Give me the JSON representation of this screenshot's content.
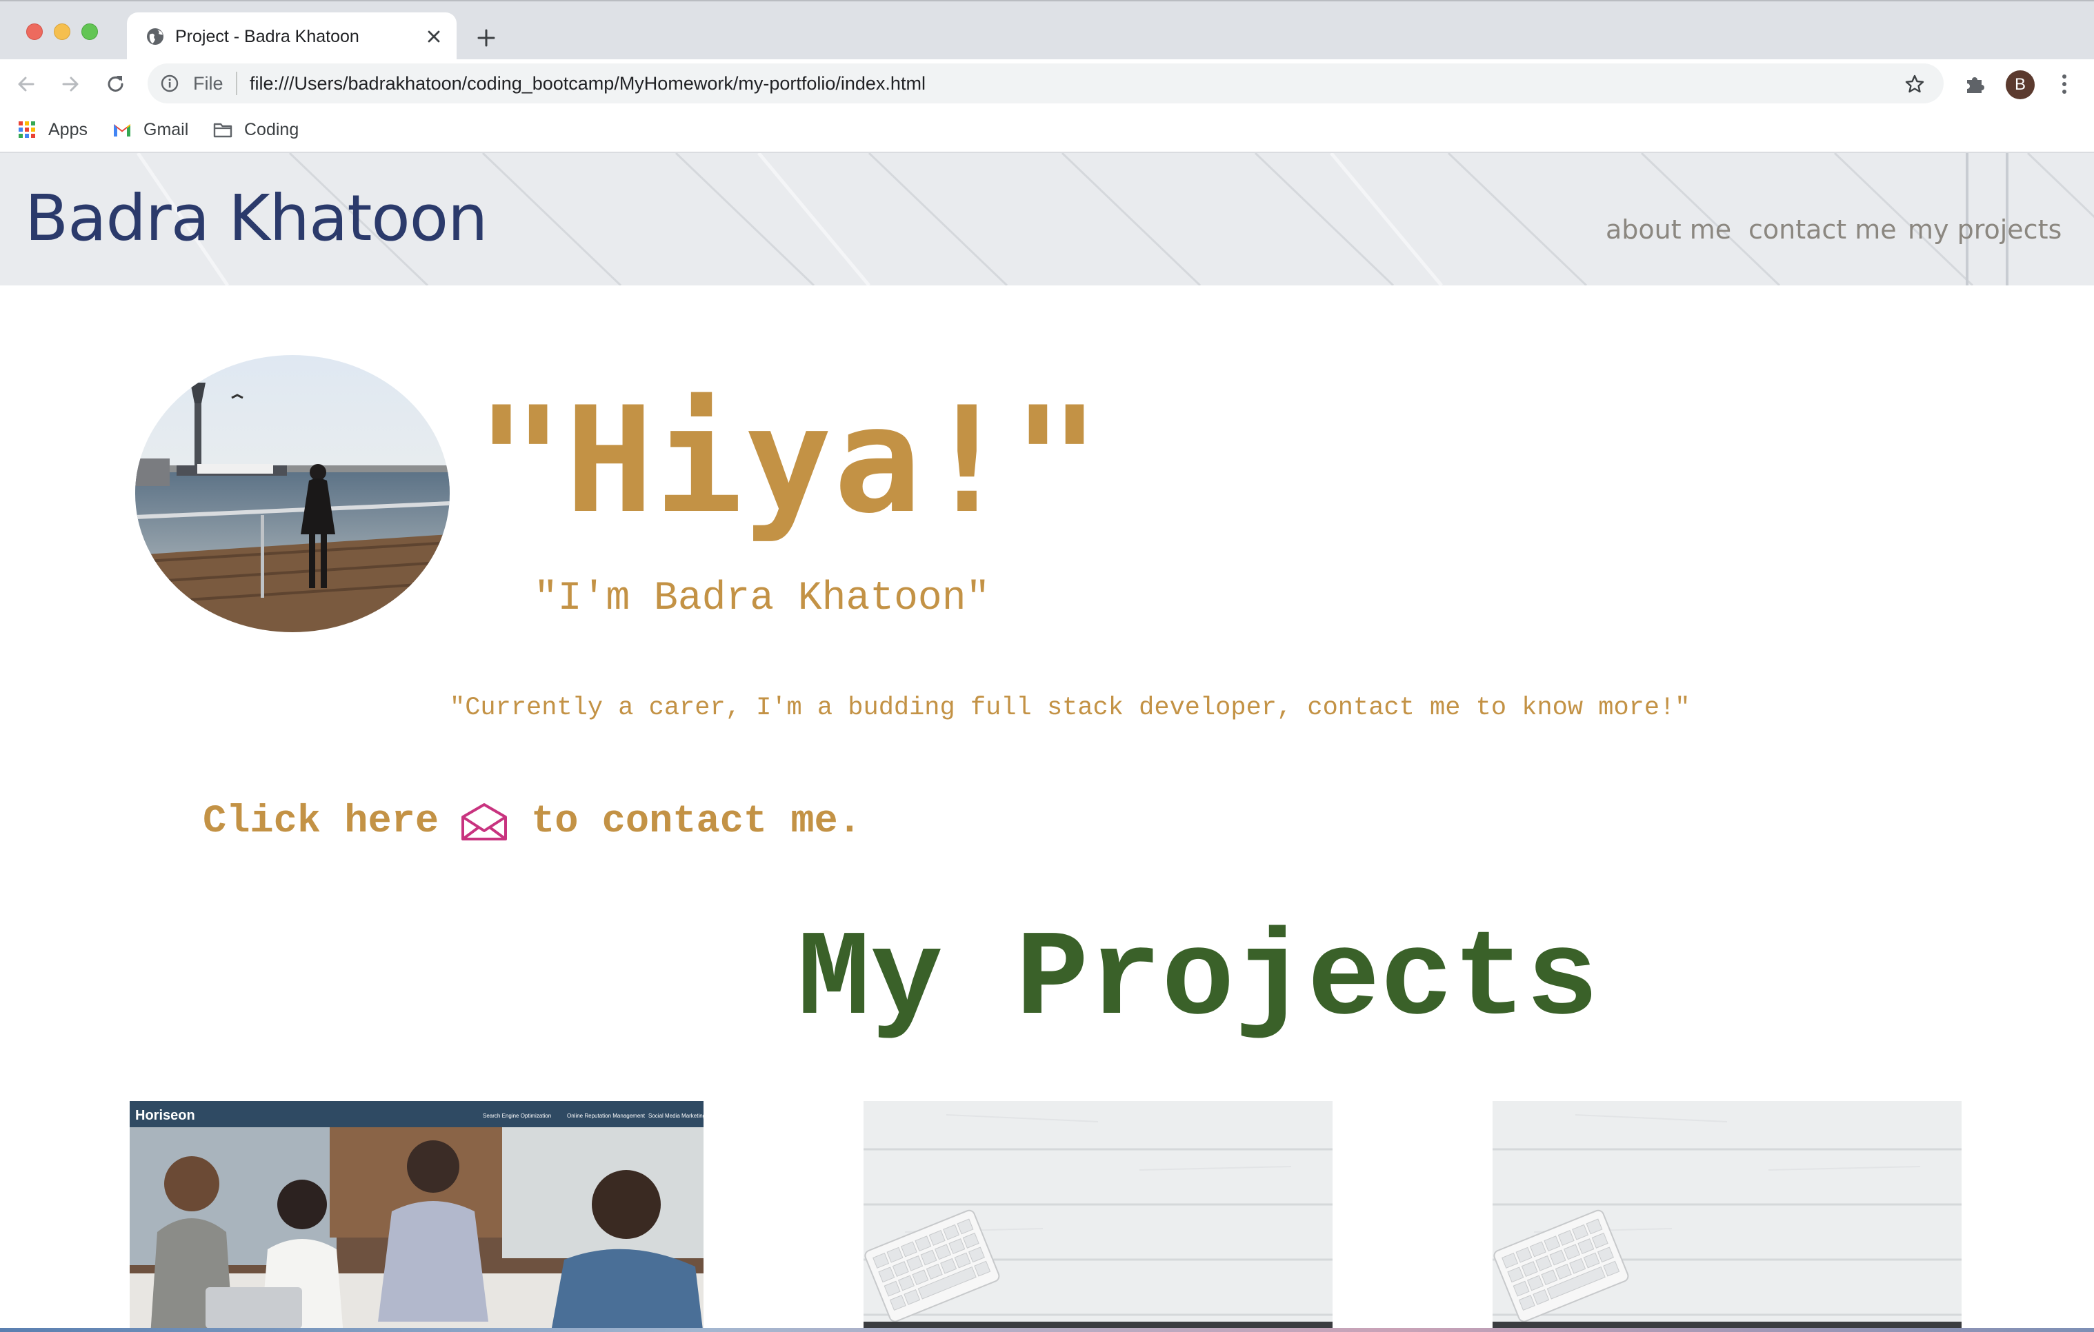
{
  "browser": {
    "tab": {
      "title": "Project - Badra Khatoon",
      "favicon": "globe-icon"
    },
    "toolbar": {
      "scheme_label": "File",
      "url": "file:///Users/badrakhatoon/coding_bootcamp/MyHomework/my-portfolio/index.html",
      "profile_initial": "B"
    },
    "bookmarks": [
      {
        "label": "Apps",
        "icon": "apps-grid-icon"
      },
      {
        "label": "Gmail",
        "icon": "gmail-icon"
      },
      {
        "label": "Coding",
        "icon": "folder-icon"
      }
    ]
  },
  "site": {
    "name": "Badra Khatoon",
    "nav": [
      {
        "label": "about me"
      },
      {
        "label": "contact me"
      },
      {
        "label": "my projects"
      }
    ],
    "hero": {
      "title": "\"Hiya!\"",
      "name_line": "\"I'm Badra Khatoon\"",
      "bio": "\"Currently a carer, I'm a budding full stack developer, contact me to know more!\""
    },
    "contact": {
      "before": "Click here",
      "icon": "envelope-icon",
      "after": "to contact me."
    },
    "projects": {
      "title": "My Projects",
      "cards": [
        {
          "brand": "Horiseon",
          "nav": [
            "Search Engine Optimization",
            "Online Reputation Management",
            "Social Media Marketing"
          ]
        },
        {},
        {}
      ]
    }
  },
  "colors": {
    "site_name": "#2b3a6b",
    "nav": "#8b8780",
    "accent_gold": "#c39245",
    "projects_green": "#3a6129",
    "envelope": "#c8337f"
  }
}
